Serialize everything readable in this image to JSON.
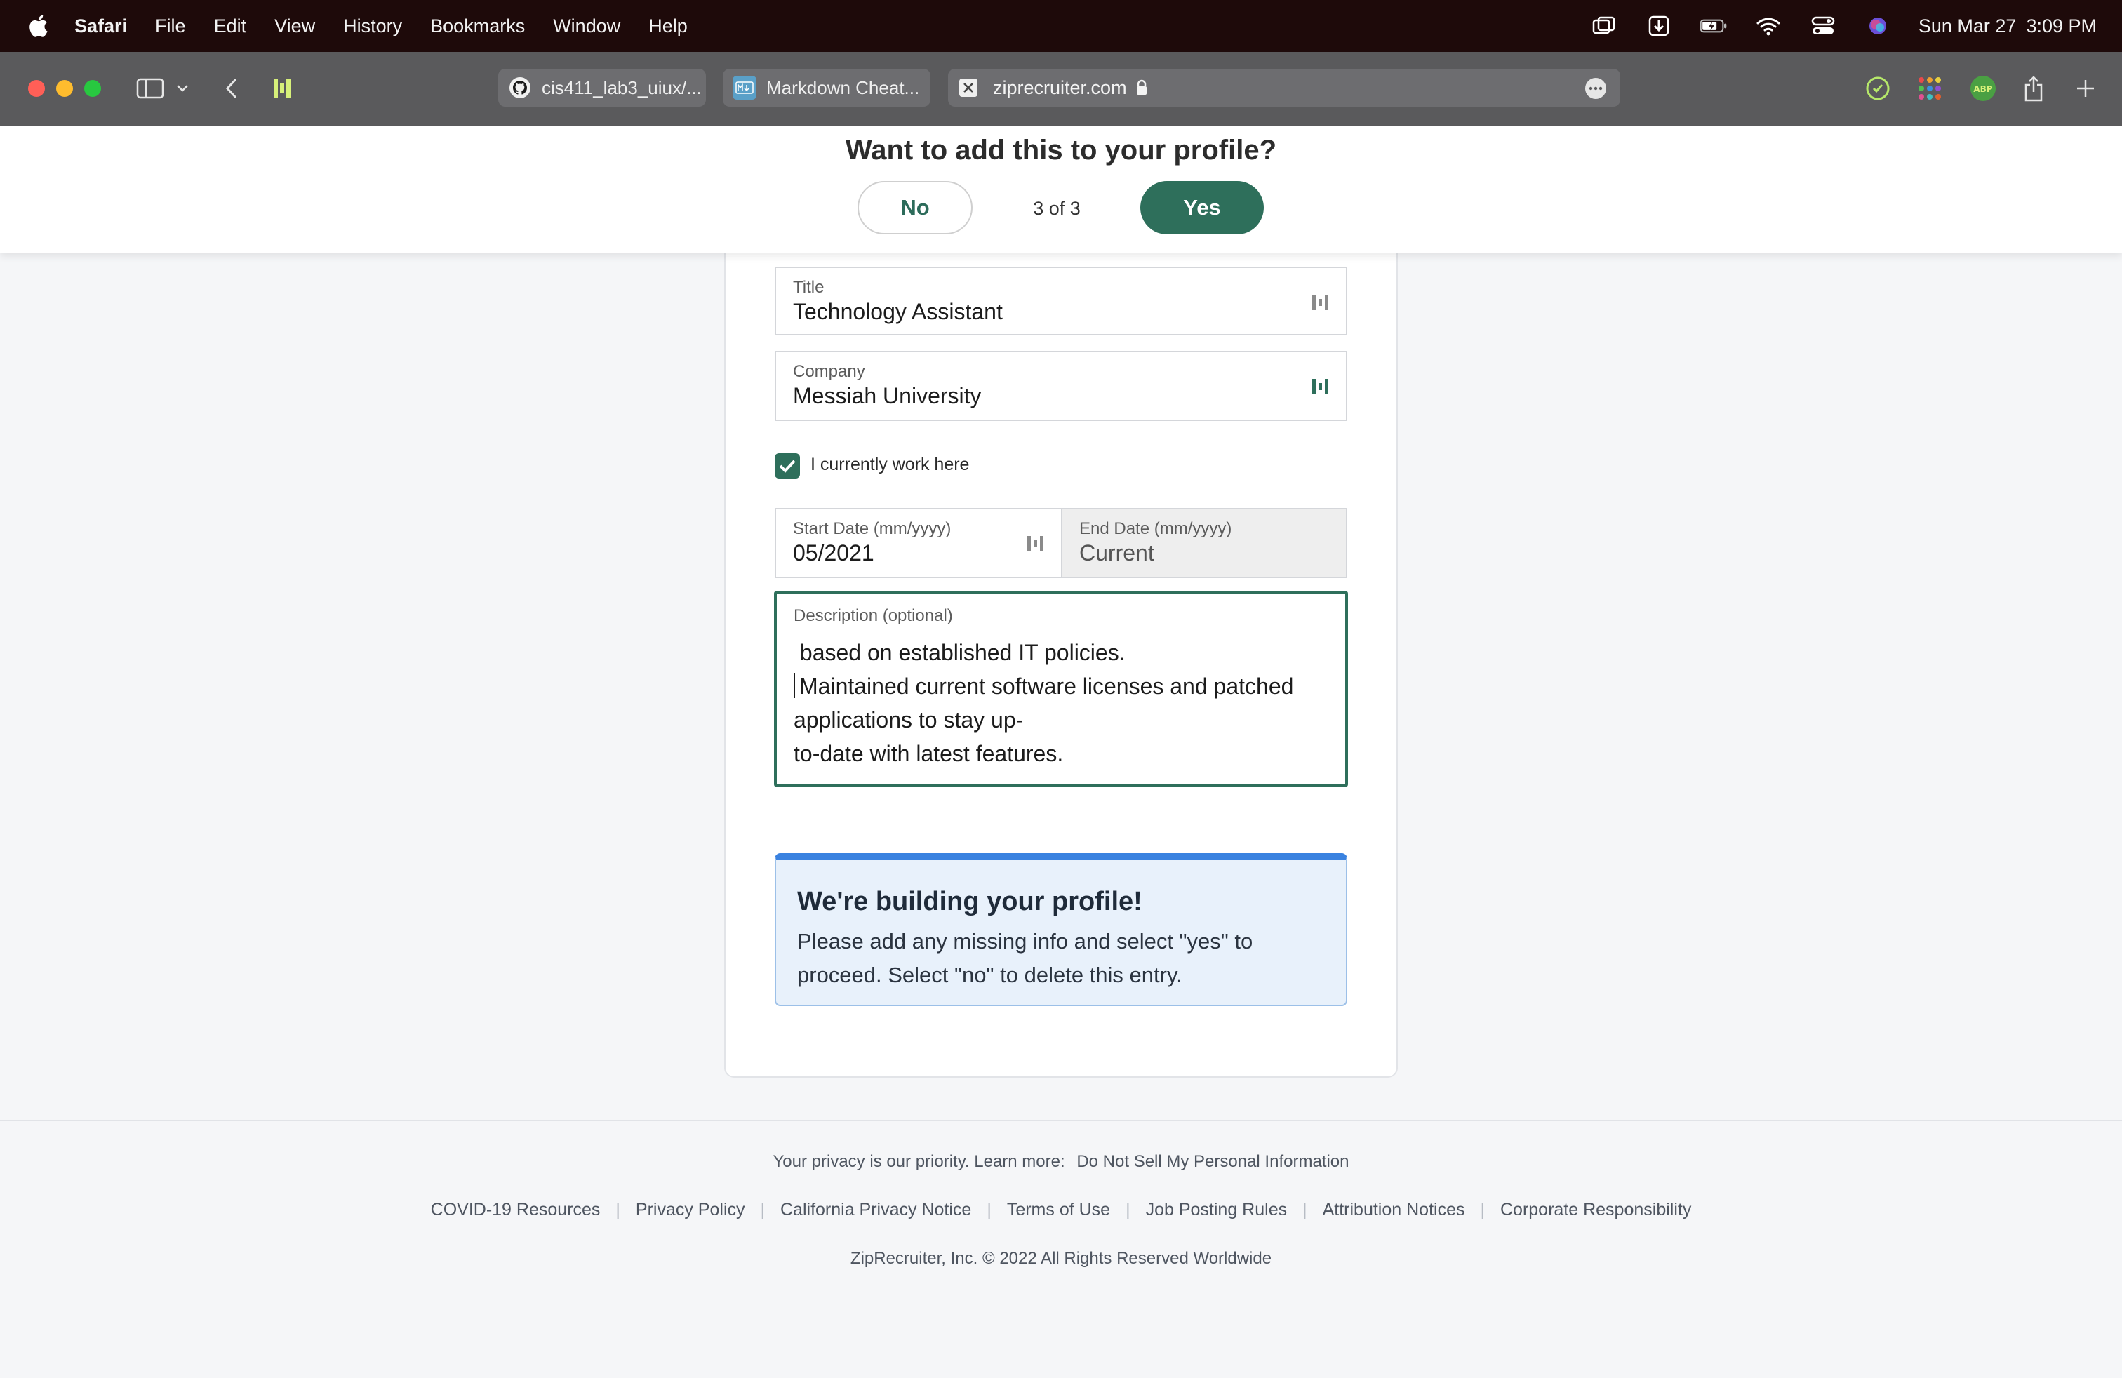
{
  "menubar": {
    "app_name": "Safari",
    "items": [
      "File",
      "Edit",
      "View",
      "History",
      "Bookmarks",
      "Window",
      "Help"
    ],
    "date": "Sun Mar 27",
    "time": "3:09 PM"
  },
  "browser": {
    "tabs": [
      {
        "label": "cis411_lab3_uiux/...",
        "icon": "github-icon"
      },
      {
        "label": "Markdown Cheat...",
        "icon": "markdown-icon"
      }
    ],
    "address": "ziprecruiter.com",
    "extension_badge": "ABP"
  },
  "banner": {
    "title": "Want to add this to your profile?",
    "no_label": "No",
    "counter": "3 of 3",
    "yes_label": "Yes"
  },
  "form": {
    "title": {
      "label": "Title",
      "value": "Technology Assistant"
    },
    "company": {
      "label": "Company",
      "value": "Messiah University"
    },
    "current_job": {
      "label": "I currently work here",
      "checked": true
    },
    "start_date": {
      "label": "Start Date (mm/yyyy)",
      "value": "05/2021"
    },
    "end_date": {
      "label": "End Date (mm/yyyy)",
      "value": "Current"
    },
    "description": {
      "label": "Description (optional)",
      "lines": [
        " based on established IT policies.",
        "Maintained current software licenses and patched applications to stay up-",
        "to-date with latest features."
      ]
    }
  },
  "notice": {
    "heading": "We're building your profile!",
    "body": "Please add any missing info and select \"yes\" to proceed. Select \"no\" to delete this entry."
  },
  "footer": {
    "privacy_text": "Your privacy is our priority. Learn more:",
    "privacy_link": "Do Not Sell My Personal Information",
    "links": [
      "COVID-19 Resources",
      "Privacy Policy",
      "California Privacy Notice",
      "Terms of Use",
      "Job Posting Rules",
      "Attribution Notices",
      "Corporate Responsibility"
    ],
    "copyright": "ZipRecruiter, Inc. © 2022 All Rights Reserved Worldwide"
  },
  "colors": {
    "brand_green": "#2e6f5b",
    "notice_blue": "#3a82e0",
    "menubar_bg": "#1e0a0a",
    "toolbar_bg": "#5a5a5c"
  }
}
